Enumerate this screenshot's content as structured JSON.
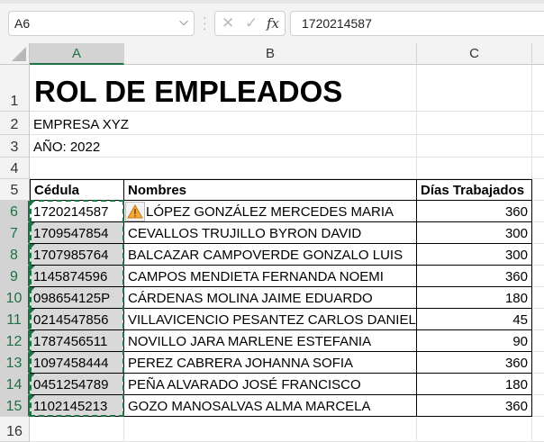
{
  "formula_bar": {
    "name_box": "A6",
    "value": "1720214587",
    "fx_label": "fx",
    "cancel": "✕",
    "enter": "✓"
  },
  "columns": [
    "A",
    "B",
    "C"
  ],
  "rows": [
    "1",
    "2",
    "3",
    "4",
    "5",
    "6",
    "7",
    "8",
    "9",
    "10",
    "11",
    "12",
    "13",
    "14",
    "15",
    "16"
  ],
  "sheet": {
    "title": "ROL DE EMPLEADOS",
    "company": "EMPRESA XYZ",
    "year": "AÑO: 2022",
    "headers": {
      "cedula": "Cédula",
      "nombres": "Nombres",
      "dias": "Días Trabajados"
    },
    "employees": [
      {
        "cedula": "1720214587",
        "nombre": "LÓPEZ GONZÁLEZ MERCEDES MARIA",
        "dias": "360"
      },
      {
        "cedula": "1709547854",
        "nombre": "CEVALLOS TRUJILLO BYRON DAVID",
        "dias": "300"
      },
      {
        "cedula": "1707985764",
        "nombre": "BALCAZAR CAMPOVERDE GONZALO LUIS",
        "dias": "300"
      },
      {
        "cedula": "1145874596",
        "nombre": "CAMPOS MENDIETA FERNANDA NOEMI",
        "dias": "360"
      },
      {
        "cedula": "098654125P",
        "nombre": "CÁRDENAS MOLINA JAIME EDUARDO",
        "dias": "180"
      },
      {
        "cedula": "0214547856",
        "nombre": "VILLAVICENCIO PESANTEZ CARLOS DANIEL",
        "dias": "45"
      },
      {
        "cedula": "1787456511",
        "nombre": "NOVILLO JARA MARLENE ESTEFANIA",
        "dias": "90"
      },
      {
        "cedula": "1097458444",
        "nombre": "PEREZ CABRERA JOHANNA SOFIA",
        "dias": "360"
      },
      {
        "cedula": "0451254789",
        "nombre": "PEÑA ALVARADO JOSÉ FRANCISCO",
        "dias": "180"
      },
      {
        "cedula": "1102145213",
        "nombre": "GOZO MANOSALVAS ALMA MARCELA",
        "dias": "360"
      }
    ]
  },
  "colors": {
    "accent": "#1e7145",
    "warning": "#f4a93a"
  }
}
